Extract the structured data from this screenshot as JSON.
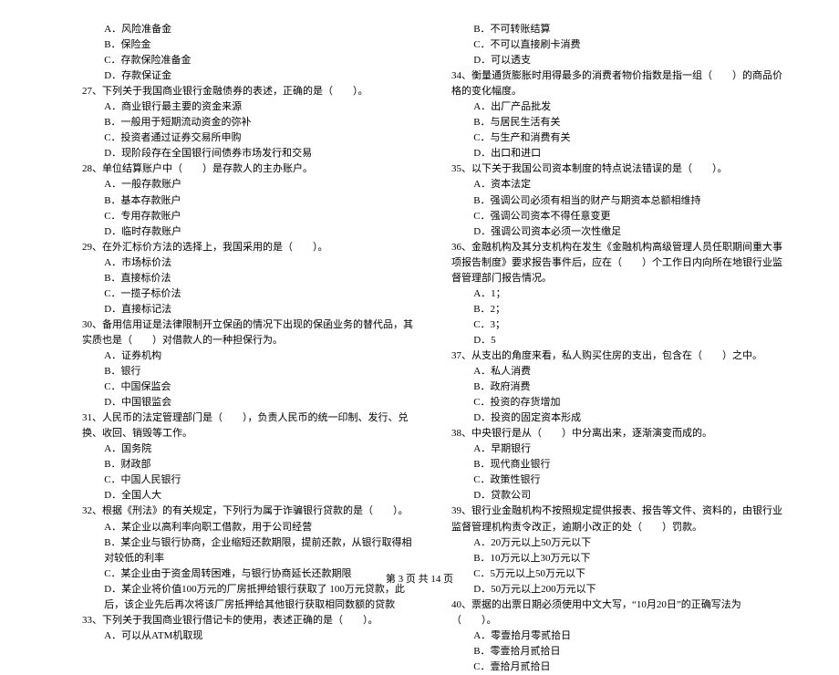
{
  "left": [
    {
      "cls": "opt",
      "text": "A．风险准备金"
    },
    {
      "cls": "opt",
      "text": "B．保险金"
    },
    {
      "cls": "opt",
      "text": "C．存款保险准备金"
    },
    {
      "cls": "opt",
      "text": "D．存款保证金"
    },
    {
      "cls": "q",
      "text": "27、下列关于我国商业银行金融债券的表述，正确的是（　　）。"
    },
    {
      "cls": "opt",
      "text": "A．商业银行最主要的资金来源"
    },
    {
      "cls": "opt",
      "text": "B．一般用于短期流动资金的弥补"
    },
    {
      "cls": "opt",
      "text": "C．投资者通过证券交易所申购"
    },
    {
      "cls": "opt",
      "text": "D．现阶段存在全国银行间债券市场发行和交易"
    },
    {
      "cls": "q",
      "text": "28、单位结算账户中（　　）是存款人的主办账户。"
    },
    {
      "cls": "opt",
      "text": "A．一般存款账户"
    },
    {
      "cls": "opt",
      "text": "B．基本存款账户"
    },
    {
      "cls": "opt",
      "text": "C．专用存款账户"
    },
    {
      "cls": "opt",
      "text": "D．临时存款账户"
    },
    {
      "cls": "q",
      "text": "29、在外汇标价方法的选择上，我国采用的是（　　）。"
    },
    {
      "cls": "opt",
      "text": "A．市场标价法"
    },
    {
      "cls": "opt",
      "text": "B．直接标价法"
    },
    {
      "cls": "opt",
      "text": "C．一揽子标价法"
    },
    {
      "cls": "opt",
      "text": "D．直接标记法"
    },
    {
      "cls": "q",
      "text": "30、备用信用证是法律限制开立保函的情况下出现的保函业务的替代品，其实质也是（　　）对借款人的一种担保行为。"
    },
    {
      "cls": "opt",
      "text": "A．证券机构"
    },
    {
      "cls": "opt",
      "text": "B．银行"
    },
    {
      "cls": "opt",
      "text": "C．中国保监会"
    },
    {
      "cls": "opt",
      "text": "D．中国银监会"
    },
    {
      "cls": "q",
      "text": "31、人民币的法定管理部门是（　　），负责人民币的统一印制、发行、兑换、收回、销毁等工作。"
    },
    {
      "cls": "opt",
      "text": "A．国务院"
    },
    {
      "cls": "opt",
      "text": "B．财政部"
    },
    {
      "cls": "opt",
      "text": "C．中国人民银行"
    },
    {
      "cls": "opt",
      "text": "D．全国人大"
    },
    {
      "cls": "q",
      "text": "32、根据《刑法》的有关规定，下列行为属于诈骗银行贷款的是（　　）。"
    },
    {
      "cls": "opt",
      "text": "A．某企业以高利率向职工借款，用于公司经营"
    },
    {
      "cls": "opt",
      "text": "B．某企业与银行协商，企业缩短还款期限，提前还款，从银行取得相对较低的利率"
    },
    {
      "cls": "opt",
      "text": "C．某企业由于资金周转困难，与银行协商延长还款期限"
    },
    {
      "cls": "opt",
      "text": "D．某企业将价值100万元的厂房抵押给银行获取了 100万元贷款，此后，该企业先后再次将该厂房抵押给其他银行获取相同数额的贷款"
    },
    {
      "cls": "q",
      "text": "33、下列关于我国商业银行借记卡的使用，表述正确的是（　　）。"
    },
    {
      "cls": "opt",
      "text": "A．可以从ATM机取现"
    }
  ],
  "right": [
    {
      "cls": "opt",
      "text": "B．不可转账结算"
    },
    {
      "cls": "opt",
      "text": "C．不可以直接刷卡消费"
    },
    {
      "cls": "opt",
      "text": "D．可以透支"
    },
    {
      "cls": "q",
      "text": "34、衡量通货膨胀时用得最多的消费者物价指数是指一组（　　）的商品价格的变化幅度。"
    },
    {
      "cls": "opt",
      "text": "A．出厂产品批发"
    },
    {
      "cls": "opt",
      "text": "B．与居民生活有关"
    },
    {
      "cls": "opt",
      "text": "C．与生产和消费有关"
    },
    {
      "cls": "opt",
      "text": "D．出口和进口"
    },
    {
      "cls": "q",
      "text": "35、以下关于我国公司资本制度的特点说法错误的是（　　）。"
    },
    {
      "cls": "opt",
      "text": "A．资本法定"
    },
    {
      "cls": "opt",
      "text": "B．强调公司必须有相当的财产与期资本总额相维持"
    },
    {
      "cls": "opt",
      "text": "C．强调公司资本不得任意变更"
    },
    {
      "cls": "opt",
      "text": "D．强调公司资本必须一次性缴足"
    },
    {
      "cls": "q",
      "text": "36、金融机构及其分支机构在发生《金融机构高级管理人员任职期间重大事项报告制度》要求报告事件后，应在（　　）个工作日内向所在地银行业监督管理部门报告情况。"
    },
    {
      "cls": "opt",
      "text": "A．1；"
    },
    {
      "cls": "opt",
      "text": "B．2；"
    },
    {
      "cls": "opt",
      "text": "C．3；"
    },
    {
      "cls": "opt",
      "text": "D．5"
    },
    {
      "cls": "q",
      "text": "37、从支出的角度来看，私人购买住房的支出，包含在（　　）之中。"
    },
    {
      "cls": "opt",
      "text": "A．私人消费"
    },
    {
      "cls": "opt",
      "text": "B．政府消费"
    },
    {
      "cls": "opt",
      "text": "C．投资的存货增加"
    },
    {
      "cls": "opt",
      "text": "D．投资的固定资本形成"
    },
    {
      "cls": "q",
      "text": "38、中央银行是从（　　）中分离出来，逐渐演变而成的。"
    },
    {
      "cls": "opt",
      "text": "A．早期银行"
    },
    {
      "cls": "opt",
      "text": "B．现代商业银行"
    },
    {
      "cls": "opt",
      "text": "C．政策性银行"
    },
    {
      "cls": "opt",
      "text": "D．贷款公司"
    },
    {
      "cls": "q",
      "text": "39、银行业金融机构不按照规定提供报表、报告等文件、资料的，由银行业监督管理机构责令改正，逾期小改正的处（　　）罚款。"
    },
    {
      "cls": "opt",
      "text": "A．20万元以上50万元以下"
    },
    {
      "cls": "opt",
      "text": "B．10万元以上30万元以下"
    },
    {
      "cls": "opt",
      "text": "C．5万元以上50万元以下"
    },
    {
      "cls": "opt",
      "text": "D．50万元以上200万元以下"
    },
    {
      "cls": "q",
      "text": "40、票据的出票日期必须使用中文大写，“10月20日”的正确写法为（　　）。"
    },
    {
      "cls": "opt",
      "text": "A．零壹拾月零贰拾日"
    },
    {
      "cls": "opt",
      "text": "B．零壹拾月贰拾日"
    },
    {
      "cls": "opt",
      "text": "C．壹拾月贰拾日"
    }
  ],
  "footer": "第 3 页 共 14 页"
}
